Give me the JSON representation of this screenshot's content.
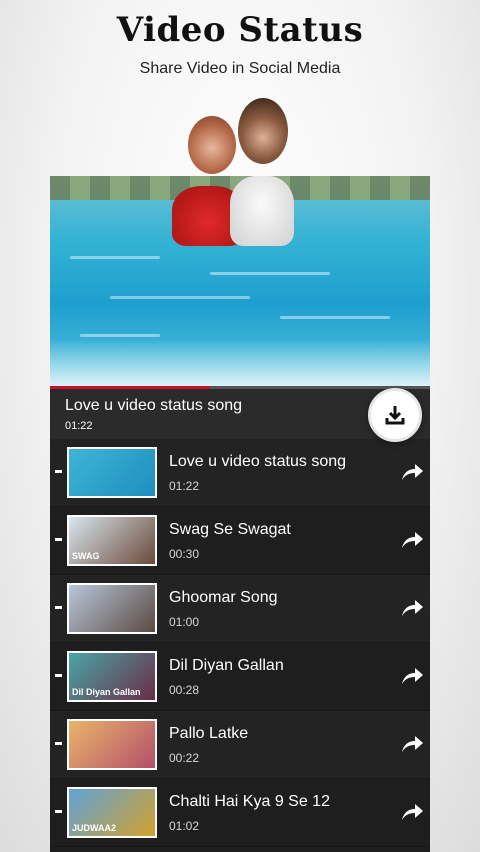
{
  "header": {
    "title": "Video Status",
    "subtitle": "Share Video in Social Media"
  },
  "player": {
    "now_playing_title": "Love u video status song",
    "now_playing_time": "01:22",
    "progress_fraction": 0.42,
    "accent_color": "#c8102e"
  },
  "icons": {
    "download": "download-icon",
    "share": "share-arrow-icon"
  },
  "videos": [
    {
      "title": "Love u video status song",
      "duration": "01:22",
      "thumb_text": "",
      "thumb_colors": [
        "#3fb4d6",
        "#1d8fbd"
      ]
    },
    {
      "title": "Swag Se Swagat",
      "duration": "00:30",
      "thumb_text": "SWAG",
      "thumb_colors": [
        "#d9e6ef",
        "#6a4a3a"
      ]
    },
    {
      "title": "Ghoomar Song",
      "duration": "01:00",
      "thumb_text": "",
      "thumb_colors": [
        "#b8c7d8",
        "#5b4a44"
      ]
    },
    {
      "title": "Dil Diyan Gallan",
      "duration": "00:28",
      "thumb_text": "Dil Diyan Gallan",
      "thumb_colors": [
        "#4aa6a8",
        "#6b2c45"
      ]
    },
    {
      "title": "Pallo Latke",
      "duration": "00:22",
      "thumb_text": "",
      "thumb_colors": [
        "#e9b46b",
        "#b34f6a"
      ]
    },
    {
      "title": "Chalti Hai Kya 9 Se 12",
      "duration": "01:02",
      "thumb_text": "JUDWAA2",
      "thumb_colors": [
        "#5fa3d6",
        "#d3a02c"
      ]
    }
  ]
}
